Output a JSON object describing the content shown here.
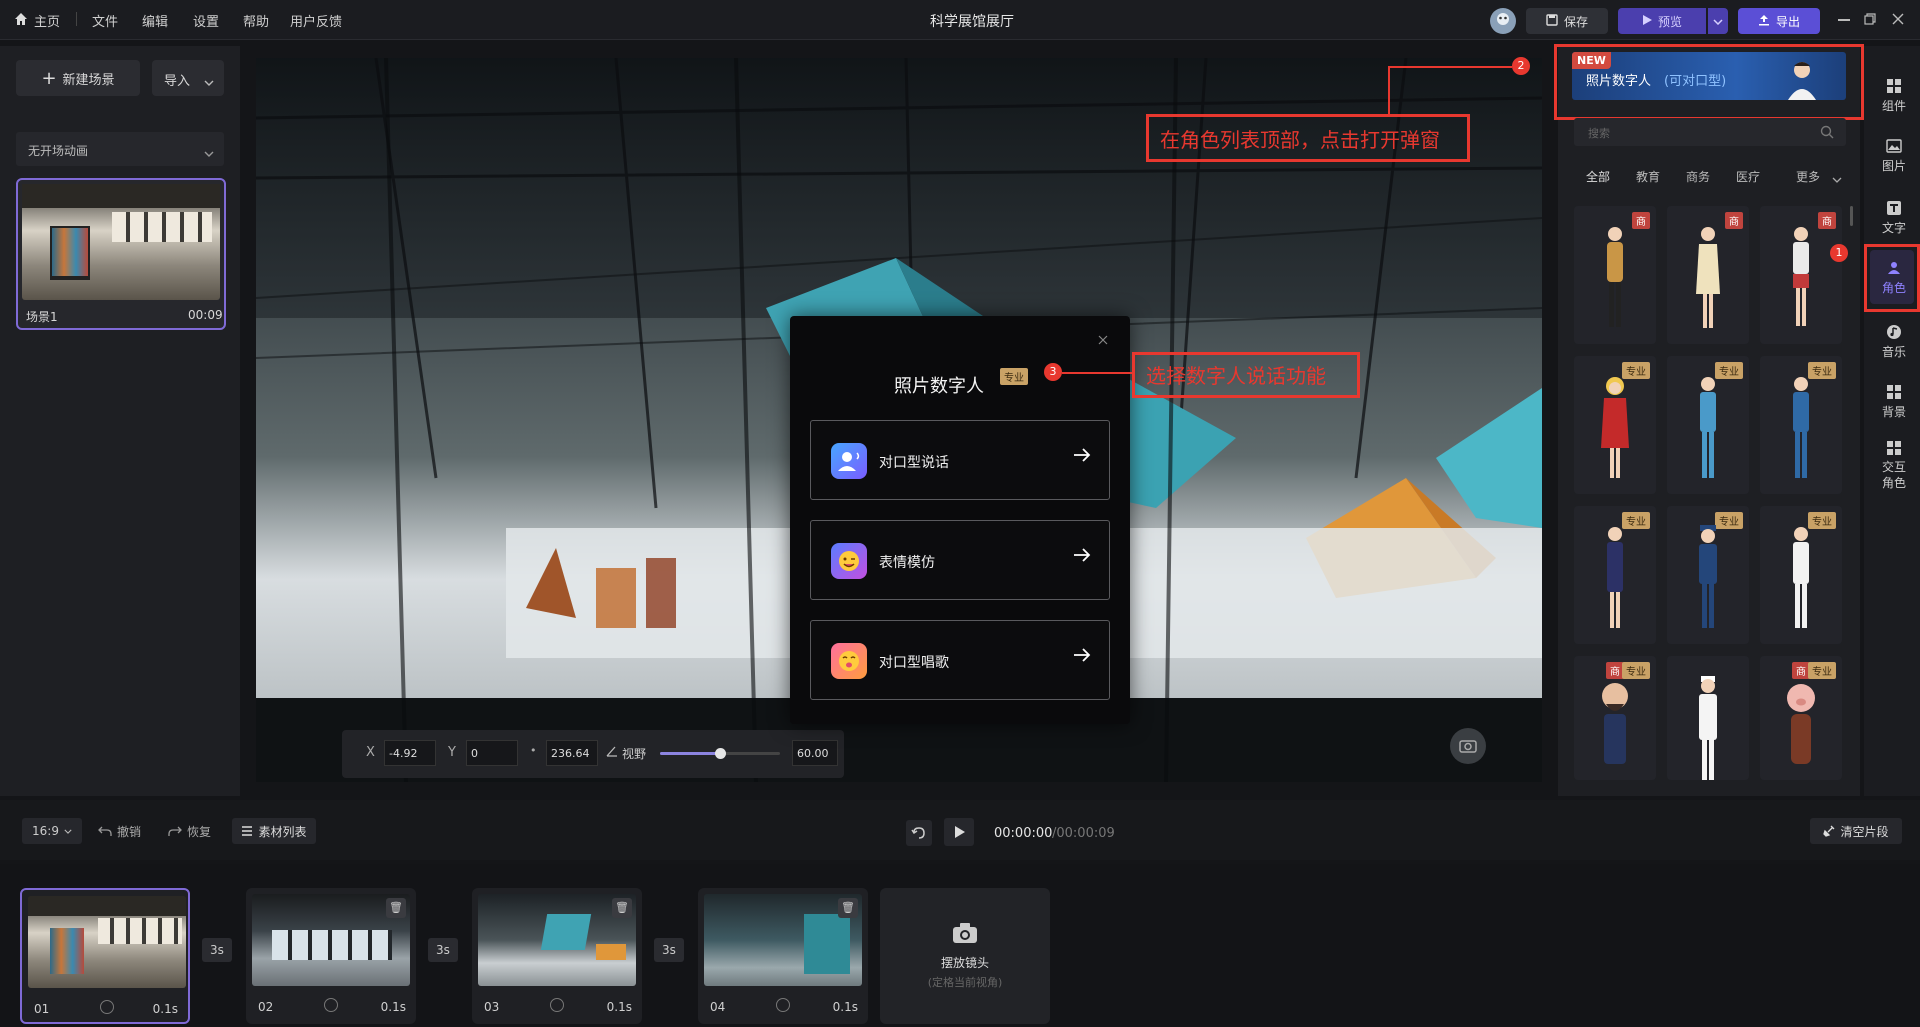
{
  "topbar": {
    "menu": [
      "主页",
      "文件",
      "编辑",
      "设置",
      "帮助",
      "用户反馈"
    ],
    "title": "科学展馆展厅",
    "save_label": "保存",
    "preview_label": "预览",
    "export_label": "导出"
  },
  "left_panel": {
    "new_scene_label": "新建场景",
    "import_label": "导入",
    "transition_select": "无开场动画",
    "scene": {
      "name": "场景1",
      "duration": "00:09"
    }
  },
  "viewport": {
    "x_label": "X",
    "x_value": "-4.92",
    "y_label": "Y",
    "y_value": "0",
    "z_value": "236.64",
    "fov_label": "视野",
    "fov_value": "60.00",
    "fov_fraction": 0.5
  },
  "modal": {
    "title": "照片数字人",
    "badge": "专业",
    "options": [
      {
        "label": "对口型说话"
      },
      {
        "label": "表情模仿"
      },
      {
        "label": "对口型唱歌"
      }
    ]
  },
  "annotations": {
    "a1_num": "1",
    "a2_num": "2",
    "a2_text": "在角色列表顶部，点击打开弹窗",
    "a3_num": "3",
    "a3_text": "选择数字人说话功能"
  },
  "right_panel": {
    "banner_new": "NEW",
    "banner_text": "照片数字人",
    "banner_sub": "(可对口型)",
    "search_placeholder": "搜索",
    "categories": [
      "全部",
      "教育",
      "商务",
      "医疗",
      "更多"
    ],
    "badge_pro": "专业",
    "badge_biz": "商"
  },
  "rail": {
    "items": [
      "组件",
      "图片",
      "文字",
      "角色",
      "音乐",
      "背景",
      "交互角色"
    ]
  },
  "controls": {
    "ratio": "16:9",
    "undo": "撤销",
    "redo": "恢复",
    "assets": "素材列表",
    "time_current": "00:00:00",
    "time_total": "/00:00:09",
    "clear": "清空片段"
  },
  "timeline": {
    "clips": [
      {
        "label": "01",
        "duration": "0.1s"
      },
      {
        "label": "02",
        "duration": "0.1s"
      },
      {
        "label": "03",
        "duration": "0.1s"
      },
      {
        "label": "04",
        "duration": "0.1s"
      }
    ],
    "gap": "3s",
    "camera_title": "摆放镜头",
    "camera_sub": "(定格当前视角)"
  },
  "colors": {
    "accent": "#5b4fd6",
    "annotation": "#e8382f"
  }
}
